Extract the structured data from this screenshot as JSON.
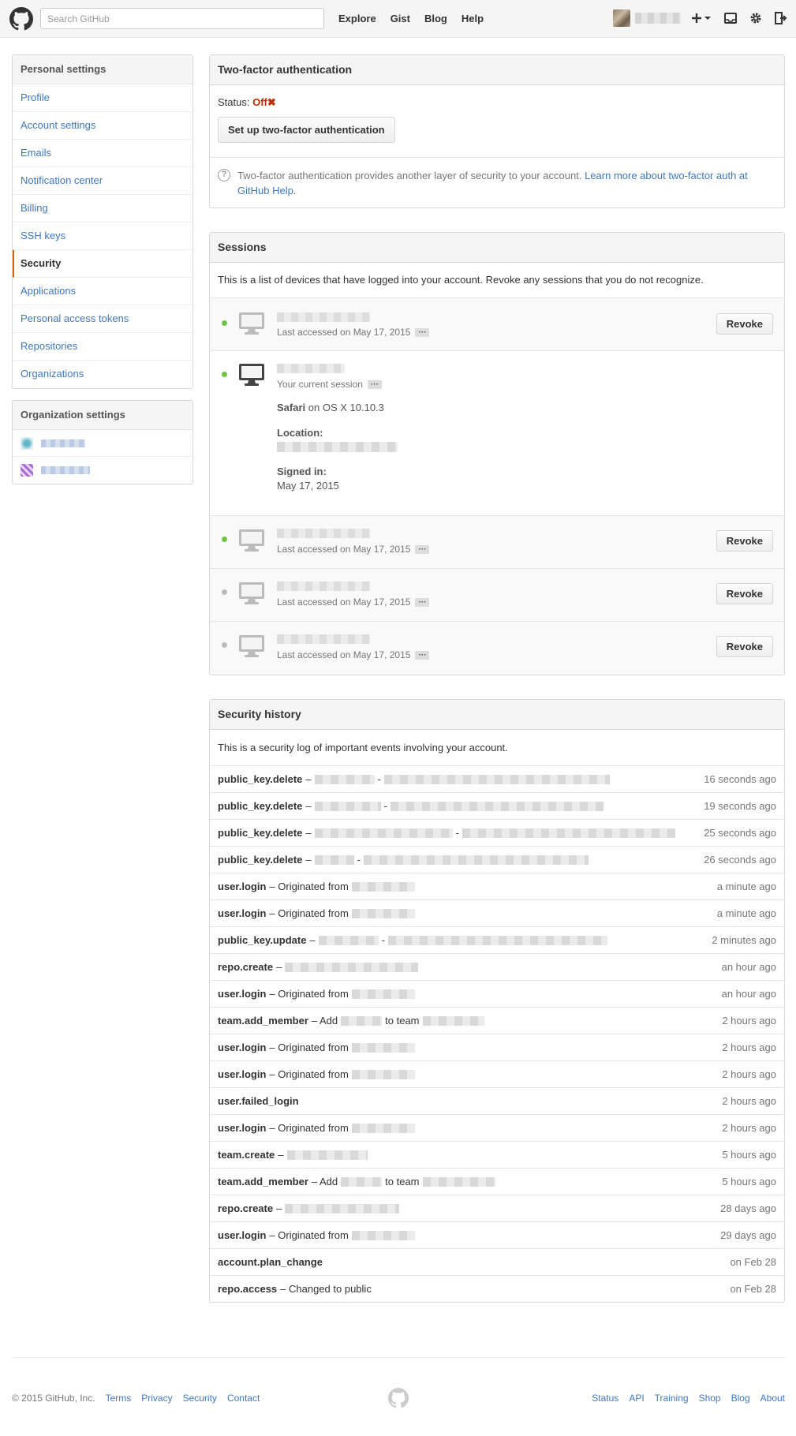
{
  "header": {
    "search_placeholder": "Search GitHub",
    "nav": [
      "Explore",
      "Gist",
      "Blog",
      "Help"
    ]
  },
  "sidebar": {
    "title": "Personal settings",
    "items": [
      "Profile",
      "Account settings",
      "Emails",
      "Notification center",
      "Billing",
      "SSH keys",
      "Security",
      "Applications",
      "Personal access tokens",
      "Repositories",
      "Organizations"
    ],
    "selected": "Security",
    "org_title": "Organization settings"
  },
  "twofactor": {
    "title": "Two-factor authentication",
    "status_label": "Status:",
    "status_value": "Off",
    "status_icon": "✖",
    "setup_button": "Set up two-factor authentication",
    "help_text": "Two-factor authentication provides another layer of security to your account.",
    "help_link": "Learn more about two-factor auth at GitHub Help."
  },
  "sessions": {
    "title": "Sessions",
    "description": "This is a list of devices that have logged into your account. Revoke any sessions that you do not recognize.",
    "last_accessed": "Last accessed on May 17, 2015",
    "revoke_label": "Revoke",
    "current": {
      "label": "Your current session",
      "browser": "Safari",
      "os": "on OS X 10.10.3",
      "location_label": "Location:",
      "signed_in_label": "Signed in:",
      "signed_in_value": "May 17, 2015"
    }
  },
  "history": {
    "title": "Security history",
    "description": "This is a security log of important events involving your account.",
    "rows": [
      {
        "action": "public_key.delete",
        "desc": "–",
        "time": "16 seconds ago"
      },
      {
        "action": "public_key.delete",
        "desc": "–",
        "time": "19 seconds ago"
      },
      {
        "action": "public_key.delete",
        "desc": "–",
        "time": "25 seconds ago"
      },
      {
        "action": "public_key.delete",
        "desc": "–",
        "time": "26 seconds ago"
      },
      {
        "action": "user.login",
        "desc": "– Originated from",
        "time": "a minute ago"
      },
      {
        "action": "user.login",
        "desc": "– Originated from",
        "time": "a minute ago"
      },
      {
        "action": "public_key.update",
        "desc": "–",
        "time": "2 minutes ago"
      },
      {
        "action": "repo.create",
        "desc": "–",
        "time": "an hour ago"
      },
      {
        "action": "user.login",
        "desc": "– Originated from",
        "time": "an hour ago"
      },
      {
        "action": "team.add_member",
        "desc": "– Add",
        "time": "2 hours ago"
      },
      {
        "action": "user.login",
        "desc": "– Originated from",
        "time": "2 hours ago"
      },
      {
        "action": "user.login",
        "desc": "– Originated from",
        "time": "2 hours ago"
      },
      {
        "action": "user.failed_login",
        "desc": "",
        "time": "2 hours ago"
      },
      {
        "action": "user.login",
        "desc": "– Originated from",
        "time": "2 hours ago"
      },
      {
        "action": "team.create",
        "desc": "–",
        "time": "5 hours ago"
      },
      {
        "action": "team.add_member",
        "desc": "– Add",
        "time": "5 hours ago"
      },
      {
        "action": "repo.create",
        "desc": "–",
        "time": "28 days ago"
      },
      {
        "action": "user.login",
        "desc": "– Originated from",
        "time": "29 days ago"
      },
      {
        "action": "account.plan_change",
        "desc": "",
        "time": "on Feb 28"
      },
      {
        "action": "repo.access",
        "desc": "– Changed to public",
        "time": "on Feb 28"
      }
    ],
    "to_team": "to team"
  },
  "footer": {
    "copyright": "© 2015 GitHub, Inc.",
    "left_links": [
      "Terms",
      "Privacy",
      "Security",
      "Contact"
    ],
    "right_links": [
      "Status",
      "API",
      "Training",
      "Shop",
      "Blog",
      "About"
    ]
  },
  "colors": {
    "link": "#4078c0",
    "off": "#bd2c00",
    "active_dot": "#6cc644",
    "selected_border": "#d26911"
  }
}
